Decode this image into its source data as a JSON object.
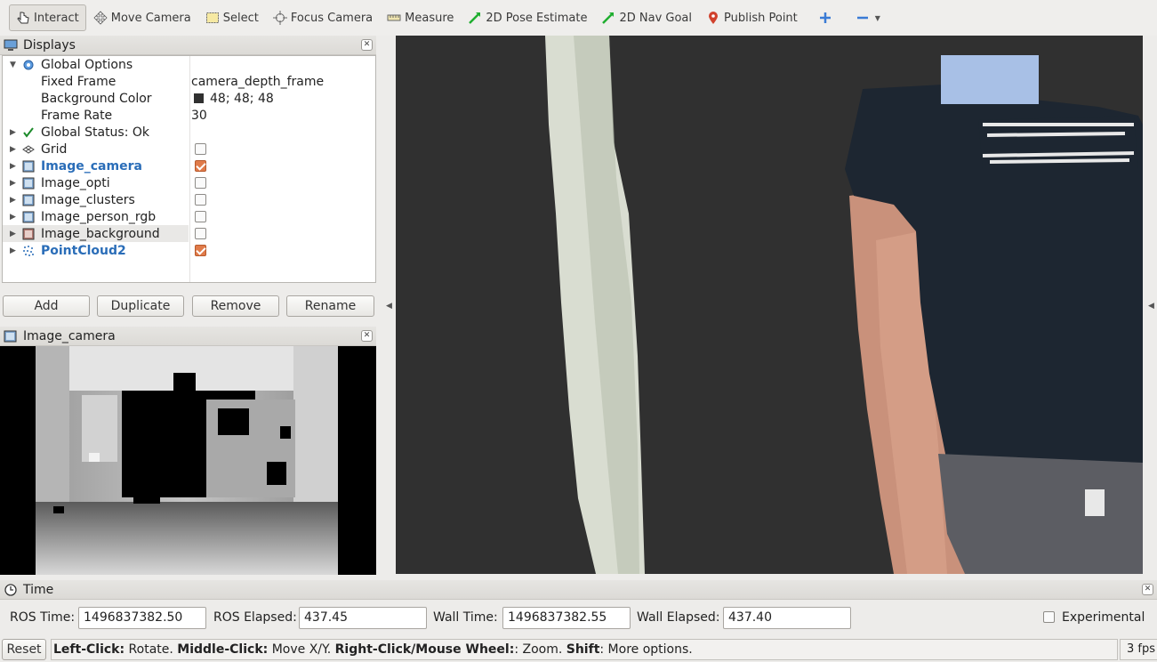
{
  "toolbar": {
    "tools": [
      {
        "label": "Interact"
      },
      {
        "label": "Move Camera"
      },
      {
        "label": "Select"
      },
      {
        "label": "Focus Camera"
      },
      {
        "label": "Measure"
      },
      {
        "label": "2D Pose Estimate"
      },
      {
        "label": "2D Nav Goal"
      },
      {
        "label": "Publish Point"
      }
    ]
  },
  "displays": {
    "title": "Displays",
    "close": "✕",
    "rows": [
      {
        "label": "Global Options",
        "value": ""
      },
      {
        "label": "Fixed Frame",
        "value": "camera_depth_frame"
      },
      {
        "label": "Background Color",
        "value": "48; 48; 48"
      },
      {
        "label": "Frame Rate",
        "value": "30"
      },
      {
        "label": "Global Status: Ok",
        "value": ""
      },
      {
        "label": "Grid",
        "value": ""
      },
      {
        "label": "Image_camera",
        "value": ""
      },
      {
        "label": "Image_opti",
        "value": ""
      },
      {
        "label": "Image_clusters",
        "value": ""
      },
      {
        "label": "Image_person_rgb",
        "value": ""
      },
      {
        "label": "Image_background",
        "value": ""
      },
      {
        "label": "PointCloud2",
        "value": ""
      }
    ],
    "checkboxes": {
      "Grid": false,
      "Image_camera": true,
      "Image_opti": false,
      "Image_clusters": false,
      "Image_person_rgb": false,
      "Image_background": false,
      "PointCloud2": true
    },
    "background_color_swatch": "#303030",
    "buttons": {
      "add": "Add",
      "duplicate": "Duplicate",
      "remove": "Remove",
      "rename": "Rename"
    }
  },
  "image_panel": {
    "title": "Image_camera",
    "close": "✕"
  },
  "time": {
    "title": "Time",
    "close": "✕",
    "ros_time_label": "ROS Time:",
    "ros_time": "1496837382.50",
    "ros_elapsed_label": "ROS Elapsed:",
    "ros_elapsed": "437.45",
    "wall_time_label": "Wall Time:",
    "wall_time": "1496837382.55",
    "wall_elapsed_label": "Wall Elapsed:",
    "wall_elapsed": "437.40",
    "experimental_label": "Experimental"
  },
  "status": {
    "reset": "Reset",
    "h1": "Left-Click:",
    "t1": " Rotate. ",
    "h2": "Middle-Click:",
    "t2": " Move X/Y. ",
    "h3": "Right-Click/Mouse Wheel:",
    "t3": ": Zoom. ",
    "h4": "Shift",
    "t4": ": More options.",
    "fps": "3 fps"
  },
  "colors": {
    "viewport_bg": "#303030",
    "accent_blue": "#2a6db8",
    "check_orange": "#e07b4a"
  }
}
